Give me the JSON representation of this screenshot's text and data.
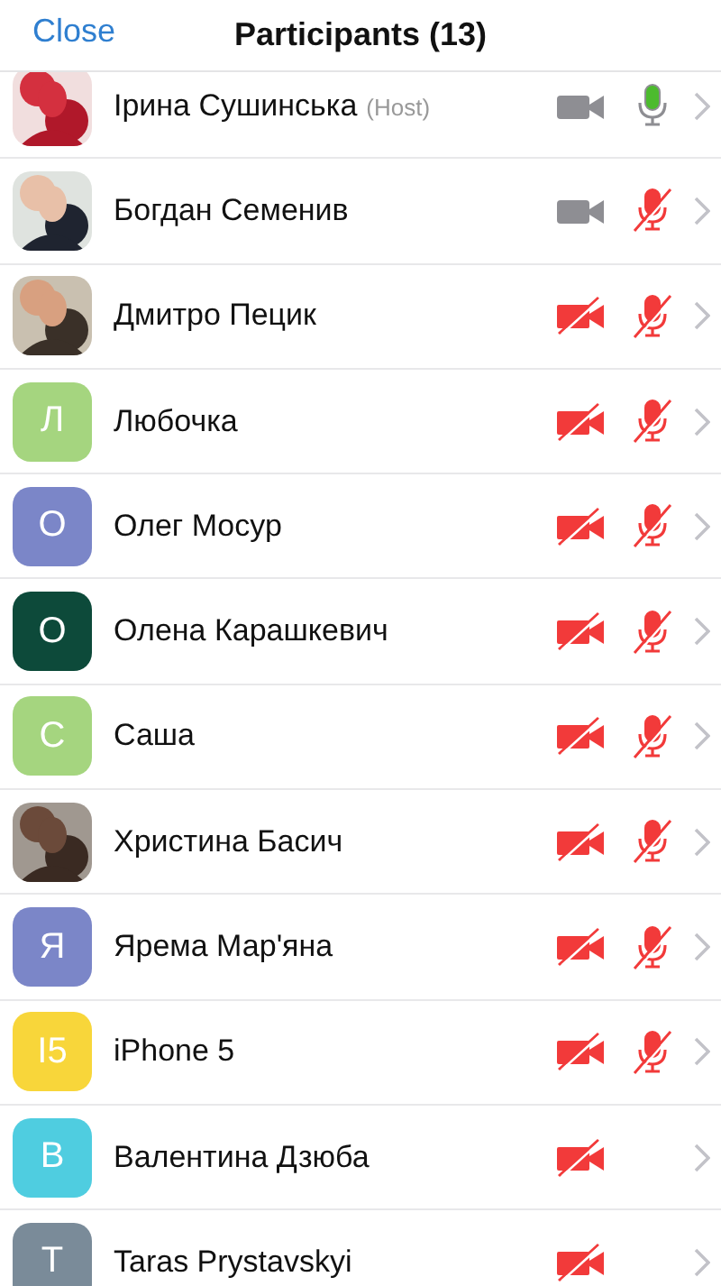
{
  "header": {
    "close": "Close",
    "title": "Participants (13)"
  },
  "participants": [
    {
      "name": "Ірина Сушинська",
      "role": "(Host)",
      "video_muted": false,
      "mic_muted": false
    },
    {
      "name": "Богдан Семенив",
      "video_muted": false,
      "mic_muted": true
    },
    {
      "name": "Дмитро Пецик",
      "video_muted": true,
      "mic_muted": true
    },
    {
      "name": "Любочка",
      "avatar": {
        "kind": "letter",
        "initial": "Л",
        "color": "#a5d57f"
      },
      "video_muted": true,
      "mic_muted": true
    },
    {
      "name": "Олег Мосур",
      "avatar": {
        "kind": "letter",
        "initial": "О",
        "color": "#7b86c8"
      },
      "video_muted": true,
      "mic_muted": true
    },
    {
      "name": "Олена Карашкевич",
      "avatar": {
        "kind": "letter",
        "initial": "О",
        "color": "#0d4a3a"
      },
      "video_muted": true,
      "mic_muted": true
    },
    {
      "name": "Саша",
      "avatar": {
        "kind": "letter",
        "initial": "С",
        "color": "#a5d57f"
      },
      "video_muted": true,
      "mic_muted": true
    },
    {
      "name": "Христина Басич",
      "video_muted": true,
      "mic_muted": true
    },
    {
      "name": "Ярема Мар'яна",
      "avatar": {
        "kind": "letter",
        "initial": "Я",
        "color": "#7b86c8"
      },
      "video_muted": true,
      "mic_muted": true
    },
    {
      "name": "iPhone 5",
      "avatar": {
        "kind": "letter",
        "initial": "I5",
        "color": "#f8d63a"
      },
      "video_muted": true,
      "mic_muted": true
    },
    {
      "name": "Валентина Дзюба",
      "avatar": {
        "kind": "letter",
        "initial": "В",
        "color": "#4fcde0"
      },
      "video_muted": true
    },
    {
      "name": "Taras Prystavskyi",
      "avatar": {
        "kind": "letter",
        "initial": "T",
        "color": "#7a8b99"
      },
      "video_muted": true
    }
  ]
}
